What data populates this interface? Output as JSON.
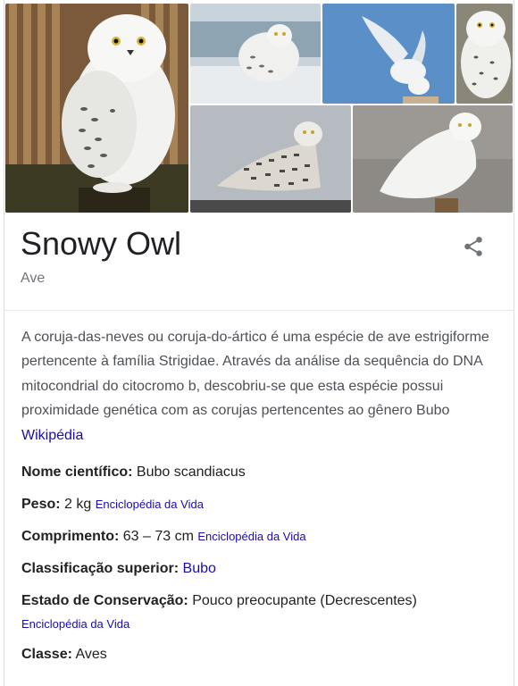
{
  "knowledge_panel": {
    "title": "Snowy Owl",
    "subtitle": "Ave",
    "share_icon": "share-icon",
    "description": {
      "text": "A coruja-das-neves ou coruja-do-ártico é uma espécie de ave estrigiforme pertencente à família Strigidae. Através da análise da sequência do DNA mitocondrial do citocromo b, descobriu-se que esta espécie possui proximidade genética com as corujas pertencentes ao gênero Bubo",
      "source": "Wikipédia"
    },
    "facts": {
      "scientific_name": {
        "label": "Nome científico:",
        "value": "Bubo scandiacus"
      },
      "weight": {
        "label": "Peso:",
        "value": "2 kg",
        "source": "Enciclopédia da Vida"
      },
      "length": {
        "label": "Comprimento:",
        "value": "63 – 73 cm",
        "source": "Enciclopédia da Vida"
      },
      "higher_classification": {
        "label": "Classificação superior:",
        "value": "Bubo"
      },
      "conservation_status": {
        "label": "Estado de Conservação:",
        "value": "Pouco preocupante (Decrescentes)",
        "source": "Enciclopédia da Vida"
      },
      "class": {
        "label": "Classe:",
        "value": "Aves"
      }
    },
    "colors": {
      "link": "#1a0dab",
      "text": "#202124",
      "muted": "#70757a",
      "body": "#4d5156"
    }
  }
}
